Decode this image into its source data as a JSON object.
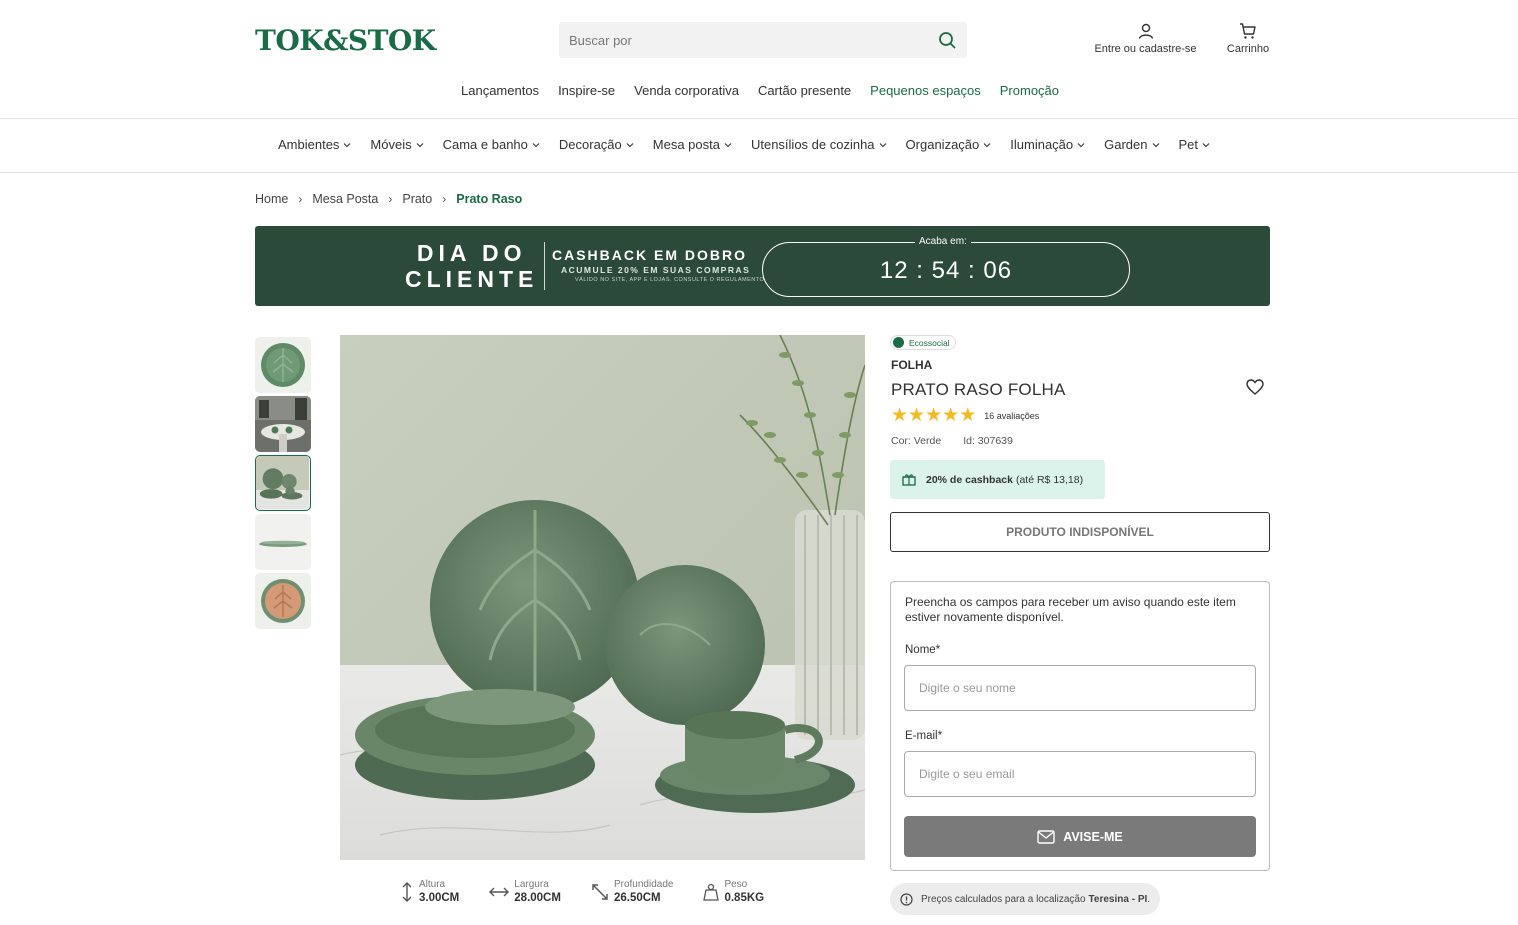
{
  "header": {
    "logo": "TOK&STOK",
    "search_placeholder": "Buscar por",
    "account_label": "Entre ou cadastre-se",
    "cart_label": "Carrinho"
  },
  "topnav": [
    {
      "label": "Lançamentos",
      "highlight": false
    },
    {
      "label": "Inspire-se",
      "highlight": false
    },
    {
      "label": "Venda corporativa",
      "highlight": false
    },
    {
      "label": "Cartão presente",
      "highlight": false
    },
    {
      "label": "Pequenos espaços",
      "highlight": true
    },
    {
      "label": "Promoção",
      "highlight": true
    }
  ],
  "categories": [
    "Ambientes",
    "Móveis",
    "Cama e banho",
    "Decoração",
    "Mesa posta",
    "Utensílios de cozinha",
    "Organização",
    "Iluminação",
    "Garden",
    "Pet"
  ],
  "breadcrumb": [
    "Home",
    "Mesa Posta",
    "Prato",
    "Prato Raso"
  ],
  "banner": {
    "title_line1": "DIA DO",
    "title_line2": "CLIENTE",
    "cashback_title": "CASHBACK EM DOBRO",
    "cashback_sub": "ACUMULE 20% EM SUAS COMPRAS",
    "cashback_fine": "VÁLIDO NO SITE, APP E LOJAS. CONSULTE O REGULAMENTO",
    "ends_label": "Acaba em:",
    "hours": "12",
    "minutes": "54",
    "seconds": "06"
  },
  "product": {
    "badge": "Ecossocial",
    "brand": "FOLHA",
    "title": "PRATO RASO FOLHA",
    "rating": 5,
    "reviews": "16 avaliações",
    "color": "Cor: Verde",
    "id": "Id: 307639",
    "cashback_bold": "20% de cashback",
    "cashback_rest": "(até R$ 13,18)",
    "unavailable_label": "PRODUTO INDISPONÍVEL"
  },
  "dimensions": [
    {
      "label": "Altura",
      "value": "3.00CM",
      "icon": "height-icon"
    },
    {
      "label": "Largura",
      "value": "28.00CM",
      "icon": "width-icon"
    },
    {
      "label": "Profundidade",
      "value": "26.50CM",
      "icon": "depth-icon"
    },
    {
      "label": "Peso",
      "value": "0.85KG",
      "icon": "weight-icon"
    }
  ],
  "notify": {
    "description": "Preencha os campos para receber um aviso quando este item estiver novamente disponível.",
    "name_label": "Nome*",
    "name_placeholder": "Digite o seu nome",
    "email_label": "E-mail*",
    "email_placeholder": "Digite o seu email",
    "button_label": "AVISE-ME"
  },
  "location": {
    "text": "Preços calculados para a localização",
    "city": "Teresina - PI",
    "suffix": "."
  },
  "colors": {
    "brand_green": "#1a6b47",
    "banner_bg": "#2b4a39",
    "cashback_bg": "#dbf3ea",
    "star": "#f5b921"
  }
}
